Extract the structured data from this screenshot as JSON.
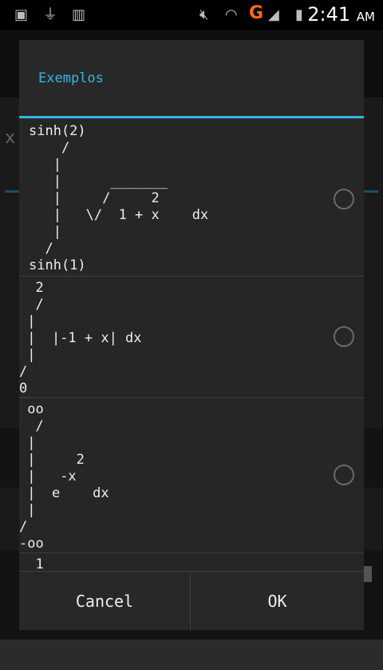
{
  "status": {
    "time": "2:41",
    "ampm": "AM",
    "network": "G",
    "icons": [
      "image-icon",
      "usb-icon",
      "barcode-icon",
      "mute-icon",
      "wifi-icon",
      "signal-icon",
      "battery-icon"
    ]
  },
  "dialog": {
    "title": "Exemplos",
    "items": [
      {
        "text": "sinh(2)\n    /\n   |\n   |      _______\n   |     /     2\n   |   \\/  1 + x    dx\n   |\n  /\nsinh(1)"
      },
      {
        "text": "  2\n  /\n |\n |  |-1 + x| dx\n |\n/\n0"
      },
      {
        "text": " oo\n  /\n |\n |     2\n |   -x\n |  e    dx\n |\n/\n-oo"
      },
      {
        "text": "  1"
      }
    ],
    "cancel_label": "Cancel",
    "ok_label": "OK"
  },
  "background": {
    "x_label": "x"
  },
  "colors": {
    "accent": "#33b5e5",
    "network": "#ff6a13"
  }
}
